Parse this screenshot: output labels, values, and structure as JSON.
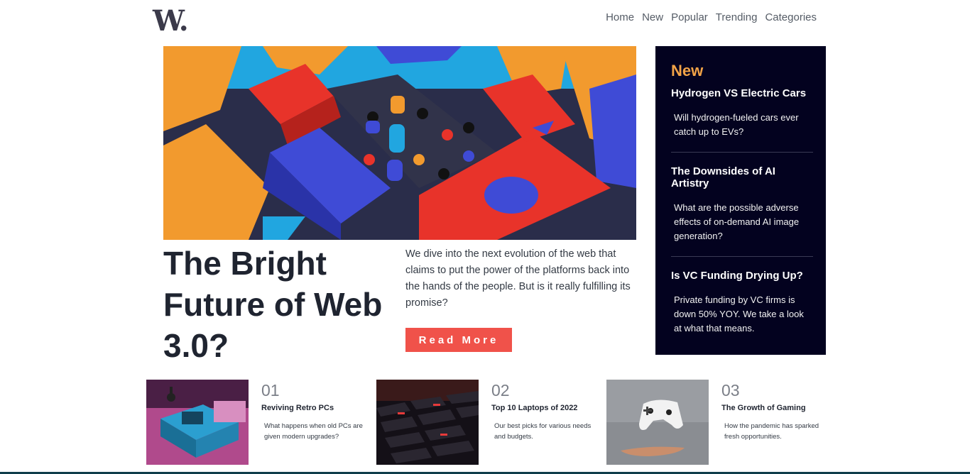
{
  "header": {
    "logo_text": "W.",
    "nav": [
      "Home",
      "New",
      "Popular",
      "Trending",
      "Categories"
    ]
  },
  "hero": {
    "title": "The Bright Future of Web 3.0?",
    "description": "We dive into the next evolution of the web that claims to put the power of the platforms back into the hands of the people. But is it really fulfilling its promise?",
    "button_label": "Read More"
  },
  "new_panel": {
    "heading": "New",
    "items": [
      {
        "title": "Hydrogen VS Electric Cars",
        "desc": "Will hydrogen-fueled cars ever catch up to EVs?"
      },
      {
        "title": "The Downsides of AI Artistry",
        "desc": "What are the possible adverse effects of on-demand AI image generation?"
      },
      {
        "title": "Is VC Funding Drying Up?",
        "desc": "Private funding by VC firms is down 50% YOY. We take a look at what that means."
      }
    ]
  },
  "cards": [
    {
      "num": "01",
      "title": "Reviving Retro PCs",
      "desc": "What happens when old PCs are given modern upgrades?"
    },
    {
      "num": "02",
      "title": "Top 10 Laptops of 2022",
      "desc": "Our best picks for various needs and budgets."
    },
    {
      "num": "03",
      "title": "The Growth of Gaming",
      "desc": "How the pandemic has sparked fresh opportunities."
    }
  ],
  "colors": {
    "accent": "#f0524a",
    "panel_bg": "#03021f",
    "panel_heading": "#f2a347"
  }
}
